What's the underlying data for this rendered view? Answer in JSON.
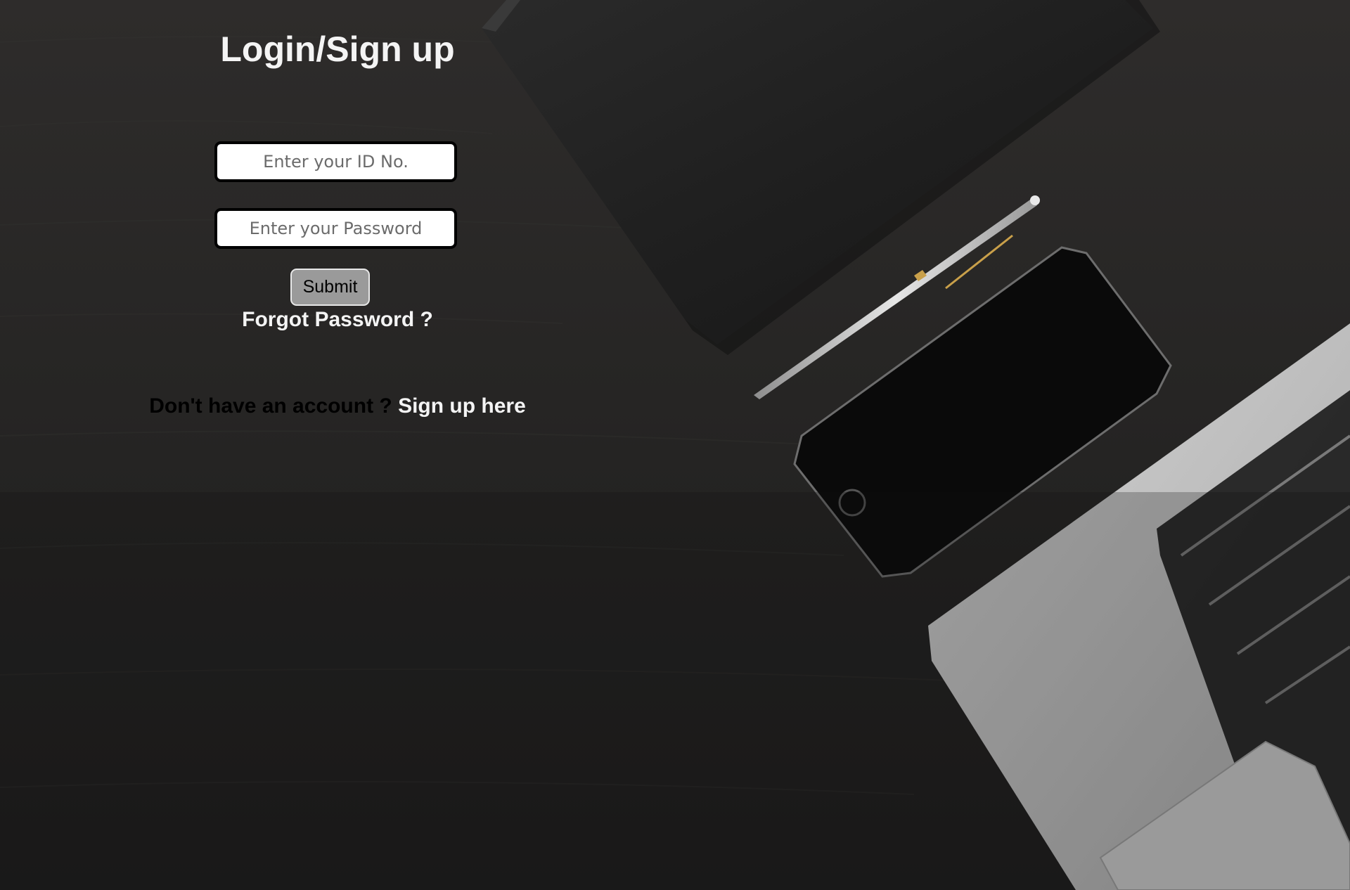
{
  "page": {
    "title": "Login/Sign up"
  },
  "form": {
    "id_placeholder": "Enter your ID No.",
    "password_placeholder": "Enter your Password",
    "submit_label": "Submit",
    "forgot_label": "Forgot Password ?"
  },
  "signup": {
    "prompt": "Don't have an account ?",
    "link_label": "Sign up here"
  },
  "colors": {
    "background": "#1c1b1b",
    "text_light": "#f4f4f4",
    "text_dark": "#000000",
    "button_fill": "#9a9a9a",
    "input_border": "#000000"
  }
}
